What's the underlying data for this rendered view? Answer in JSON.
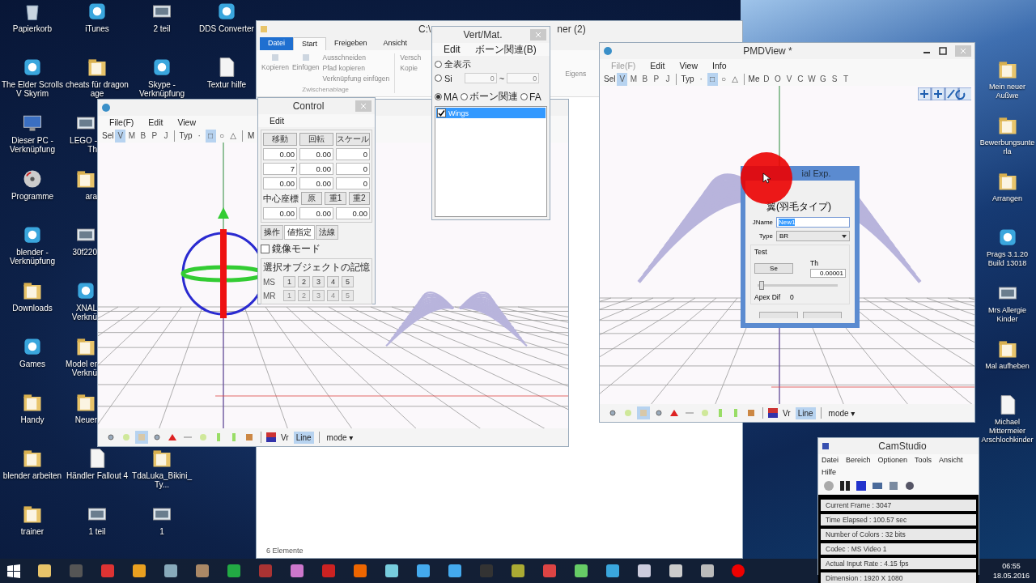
{
  "desktop": {
    "columns": [
      {
        "top": [
          {
            "label": "Papierkorb",
            "kind": "bin"
          },
          {
            "label": "The Elder Scrolls V Skyrim",
            "kind": "app"
          },
          {
            "label": "Dieser PC - Verknüpfung",
            "kind": "pc"
          },
          {
            "label": "Programme",
            "kind": "disc"
          },
          {
            "label": "blender - Verknüpfung",
            "kind": "app"
          },
          {
            "label": "Downloads",
            "kind": "folder"
          },
          {
            "label": "Games",
            "kind": "app"
          },
          {
            "label": "Handy",
            "kind": "folder"
          },
          {
            "label": "blender arbeiten",
            "kind": "folder"
          },
          {
            "label": "trainer",
            "kind": "folder"
          }
        ]
      },
      {
        "top": [
          {
            "label": "iTunes",
            "kind": "app",
            "partial": false
          },
          {
            "label": "cheats für dragon age",
            "kind": "folder",
            "partial": false
          },
          {
            "label": "LEGO - Th",
            "kind": "image",
            "partial": true
          },
          {
            "label": "ara",
            "kind": "folder",
            "partial": true
          },
          {
            "label": "30f220",
            "kind": "image",
            "partial": true
          },
          {
            "label": "XNAL Verknü",
            "kind": "app",
            "partial": true
          },
          {
            "label": "Model er Verknü",
            "kind": "folder",
            "partial": true
          },
          {
            "label": "Neuer",
            "kind": "folder",
            "partial": true
          },
          {
            "label": "Händler Fallout 4",
            "kind": "document",
            "partial": false
          },
          {
            "label": "1 teil",
            "kind": "image",
            "partial": false
          }
        ]
      },
      {
        "top": [
          {
            "label": "2 teil",
            "kind": "image"
          },
          {
            "label": "Skype - Verknüpfung",
            "kind": "app"
          }
        ],
        "bottom": [
          {
            "label": "TdaLuka_Bikini_Ty...",
            "kind": "folder"
          },
          {
            "label": "1",
            "kind": "image"
          }
        ]
      },
      {
        "top": [
          {
            "label": "DDS Converter",
            "kind": "app"
          },
          {
            "label": "Textur hilfe",
            "kind": "document"
          }
        ]
      }
    ],
    "right_icons": [
      {
        "label": "Mein neuer Außwe",
        "kind": "folder"
      },
      {
        "label": "Bewerbungsunterla",
        "kind": "folder"
      },
      {
        "label": "Arrangen",
        "kind": "folder"
      },
      {
        "label": "Prags 3.1.20 Build 13018",
        "kind": "app"
      },
      {
        "label": "Mrs Allergie Kinder",
        "kind": "image"
      },
      {
        "label": "Mal aufheben",
        "kind": "folder"
      },
      {
        "label": "Michael Mittermeier Arschlochkinder",
        "kind": "document"
      }
    ]
  },
  "explorer": {
    "title": "C:\\",
    "title_end": "ner (2)",
    "tabs": [
      {
        "label": "Datei",
        "kind": "file",
        "selected": false
      },
      {
        "label": "Start",
        "kind": "tab",
        "selected": true
      },
      {
        "label": "Freigeben",
        "kind": "tab",
        "selected": false
      },
      {
        "label": "Ansicht",
        "kind": "tab",
        "selected": false
      }
    ],
    "big_buttons": [
      "Kopieren",
      "Einfügen"
    ],
    "small_buttons": [
      "Ausschneiden",
      "Pfad kopieren",
      "Verknüpfung einfügen"
    ],
    "group": "Zwischenablage",
    "more_buttons": [
      "Versch",
      "Kopie"
    ],
    "cut_button": "Eigens",
    "status": "6 Elemente"
  },
  "editor": {
    "menu": [
      "File(F)",
      "Edit",
      "View"
    ],
    "toolbar": [
      {
        "kind": "label",
        "label": "Sel"
      },
      {
        "kind": "toggle",
        "label": "V",
        "selected": true
      },
      {
        "kind": "toggle",
        "label": "M",
        "selected": false
      },
      {
        "kind": "toggle",
        "label": "B",
        "selected": false
      },
      {
        "kind": "toggle",
        "label": "P",
        "selected": false
      },
      {
        "kind": "toggle",
        "label": "J",
        "selected": false
      },
      {
        "kind": "sep"
      },
      {
        "kind": "label",
        "label": "Typ"
      },
      {
        "kind": "toggle",
        "label": "·",
        "selected": false
      },
      {
        "kind": "toggle",
        "label": "□",
        "selected": true
      },
      {
        "kind": "toggle",
        "label": "○",
        "selected": false
      },
      {
        "kind": "toggle",
        "label": "△",
        "selected": false
      },
      {
        "kind": "sep"
      },
      {
        "kind": "label",
        "label": "M"
      }
    ],
    "bottom_tools": [
      {
        "kind": "dot",
        "selected": false
      },
      {
        "kind": "blob",
        "selected": false
      },
      {
        "kind": "square",
        "selected": true
      },
      {
        "kind": "dot",
        "selected": false
      },
      {
        "kind": "triangle",
        "selected": false
      },
      {
        "kind": "dash",
        "selected": false
      },
      {
        "kind": "blob",
        "selected": false
      },
      {
        "kind": "bar",
        "selected": false
      },
      {
        "kind": "bar",
        "selected": false
      },
      {
        "kind": "cube",
        "selected": false
      }
    ],
    "vr": "Vr",
    "line": {
      "label": "Line",
      "selected": true
    },
    "mode": "mode ▾"
  },
  "control": {
    "title": "Control",
    "menu": "Edit",
    "buttons": [
      "移動",
      "回転",
      "スケール"
    ],
    "values": [
      [
        "0.00",
        "0.00",
        "0"
      ],
      [
        "7",
        "0.00",
        "0"
      ],
      [
        "0.00",
        "0.00",
        "0"
      ]
    ],
    "center_label": "中心座標",
    "center_buttons": [
      "原",
      "重1",
      "重2"
    ],
    "center_values": [
      "0.00",
      "0.00",
      "0.00"
    ],
    "tabs": [
      {
        "label": "操作",
        "selected": false
      },
      {
        "label": "値指定",
        "selected": true
      },
      {
        "label": "法線",
        "selected": false
      }
    ],
    "mirror": {
      "label": "鏡像モード",
      "checked": false
    },
    "memory_title": "選択オブジェクトの記憶",
    "memory_rows": [
      {
        "label": "MS",
        "disabled": false,
        "buttons": [
          "1",
          "2",
          "3",
          "4",
          "5"
        ]
      },
      {
        "label": "MR",
        "disabled": true,
        "buttons": [
          "1",
          "2",
          "3",
          "4",
          "5"
        ]
      }
    ]
  },
  "vertmat": {
    "title": "Vert/Mat.",
    "menu": [
      "Edit",
      "ボーン関連(B)"
    ],
    "range_radios": [
      {
        "label": "全表示",
        "selected": false
      },
      {
        "label": "Si",
        "selected": false
      }
    ],
    "range_from": "0",
    "range_sep": "~",
    "range_to": "0",
    "mode_radios": [
      {
        "label": "MA",
        "selected": true
      },
      {
        "label": "ボーン関連",
        "selected": false
      },
      {
        "label": "FA",
        "selected": false
      }
    ],
    "items": [
      {
        "label": "Wings",
        "checked": true,
        "selected": true
      }
    ]
  },
  "pmdview": {
    "title": "PMDView *",
    "menu": [
      {
        "label": "File(F)",
        "disabled": true
      },
      {
        "label": "Edit",
        "disabled": false
      },
      {
        "label": "View",
        "disabled": false
      },
      {
        "label": "Info",
        "disabled": false
      }
    ],
    "toolbar": [
      {
        "kind": "label",
        "label": "Sel"
      },
      {
        "kind": "toggle",
        "label": "V",
        "selected": true
      },
      {
        "kind": "toggle",
        "label": "M",
        "selected": false
      },
      {
        "kind": "toggle",
        "label": "B",
        "selected": false
      },
      {
        "kind": "toggle",
        "label": "P",
        "selected": false
      },
      {
        "kind": "toggle",
        "label": "J",
        "selected": false
      },
      {
        "kind": "sep"
      },
      {
        "kind": "label",
        "label": "Typ"
      },
      {
        "kind": "toggle",
        "label": "·",
        "selected": false
      },
      {
        "kind": "toggle",
        "label": "□",
        "selected": true
      },
      {
        "kind": "toggle",
        "label": "○",
        "selected": false
      },
      {
        "kind": "toggle",
        "label": "△",
        "selected": false
      },
      {
        "kind": "sep"
      },
      {
        "kind": "label",
        "label": "Me"
      },
      {
        "kind": "toggle",
        "label": "D",
        "selected": false
      },
      {
        "kind": "toggle",
        "label": "O",
        "selected": false
      },
      {
        "kind": "toggle",
        "label": "V",
        "selected": false
      },
      {
        "kind": "toggle",
        "label": "C",
        "selected": false
      },
      {
        "kind": "toggle",
        "label": "W",
        "selected": false
      },
      {
        "kind": "toggle",
        "label": "G",
        "selected": false
      },
      {
        "kind": "toggle",
        "label": "S",
        "selected": false
      },
      {
        "kind": "toggle",
        "label": "T",
        "selected": false
      }
    ],
    "bottom_tools": [
      {
        "kind": "dot",
        "selected": false
      },
      {
        "kind": "blob",
        "selected": false
      },
      {
        "kind": "square",
        "selected": true
      },
      {
        "kind": "dot",
        "selected": false
      },
      {
        "kind": "triangle",
        "selected": false
      },
      {
        "kind": "dash",
        "selected": false
      },
      {
        "kind": "blob",
        "selected": false
      },
      {
        "kind": "bar",
        "selected": false
      },
      {
        "kind": "bar",
        "selected": false
      },
      {
        "kind": "cube",
        "selected": false
      }
    ],
    "vr": "Vr",
    "line": {
      "label": "Line",
      "selected": true
    },
    "mode": "mode ▾"
  },
  "dialog": {
    "title": "ial Exp.",
    "model": "翼(羽毛タイプ)",
    "jname_label": "JName",
    "jname": "New1",
    "type_label": "Type",
    "type": "BR",
    "test_label": "Test",
    "se": "Se",
    "th_label": "Th",
    "th": "0.00001",
    "slider": {
      "level": 0.02
    },
    "apex_label": "Apex Dif",
    "apex": "0"
  },
  "camstudio": {
    "title": "CamStudio",
    "menu": [
      "Datei",
      "Bereich",
      "Optionen",
      "Tools",
      "Ansicht",
      "Hilfe"
    ],
    "stats": [
      "Current Frame : 3047",
      "Time Elapsed : 100.57 sec",
      "Number of Colors : 32 bits",
      "Codec : MS Video 1",
      "Actual Input Rate : 4.15 fps",
      "Dimension : 1920 X 1080"
    ]
  },
  "taskbar": {
    "time": "06:55",
    "date": "18.05.2016"
  }
}
